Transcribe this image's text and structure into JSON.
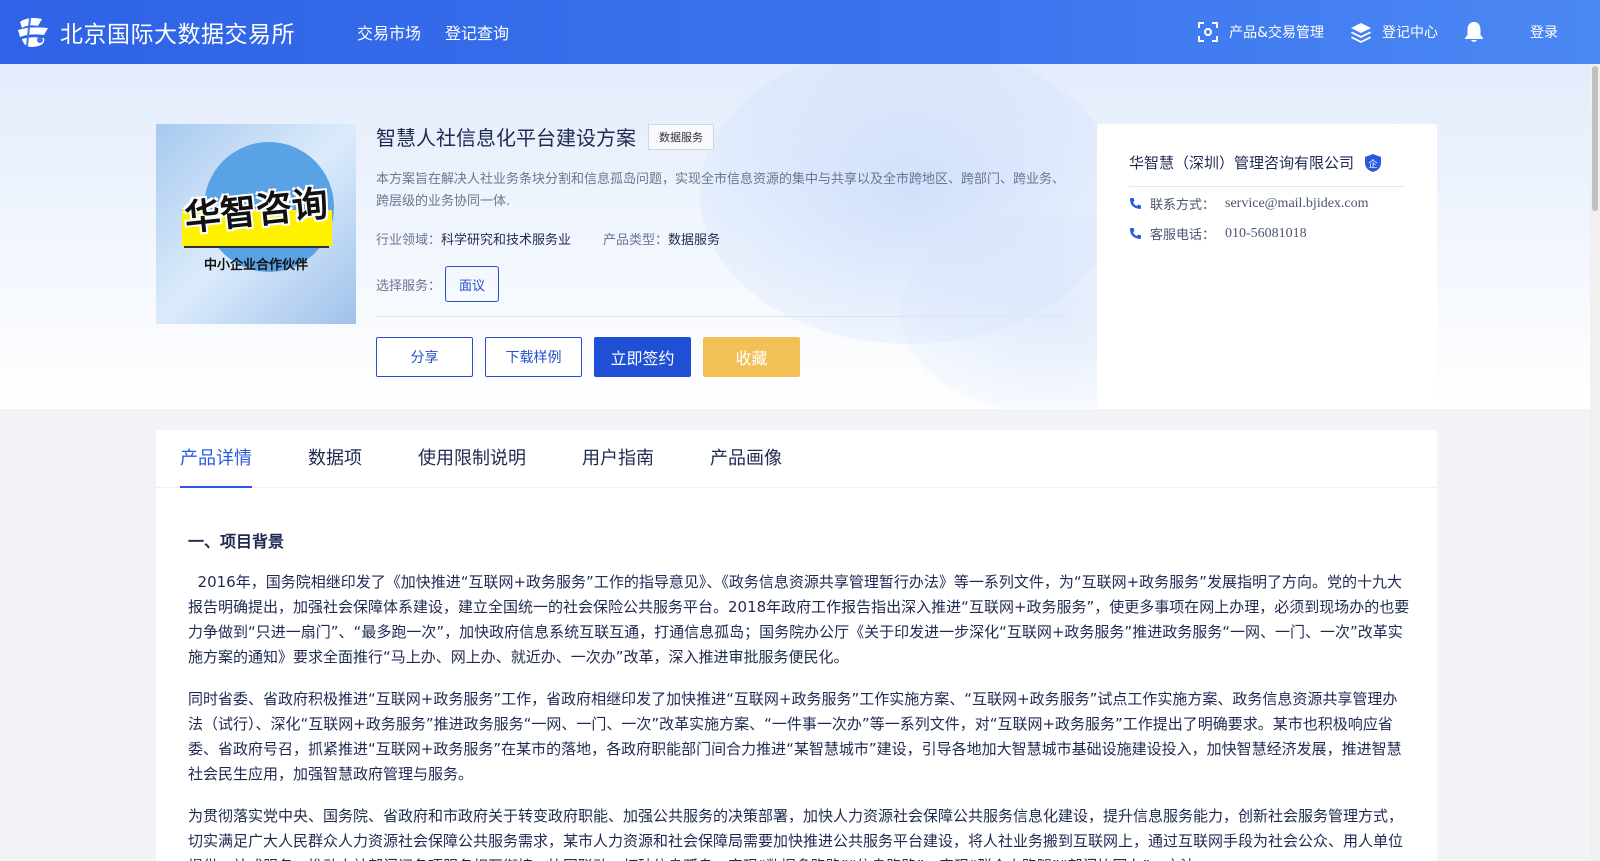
{
  "header": {
    "logo_text": "北京国际大数据交易所",
    "nav": [
      "交易市场",
      "登记查询"
    ],
    "product_mgmt": "产品&交易管理",
    "register_center": "登记中心",
    "login": "登录"
  },
  "product": {
    "image_title": "华智咨询",
    "image_subtitle": "中小企业合作伙伴",
    "title": "智慧人社信息化平台建设方案",
    "tag": "数据服务",
    "description": "本方案旨在解决人社业务条块分割和信息孤岛问题，实现全市信息资源的集中与共享以及全市跨地区、跨部门、跨业务、跨层级的业务协同一体.",
    "industry_label": "行业领域：",
    "industry_value": "科学研究和技术服务业",
    "type_label": "产品类型：",
    "type_value": "数据服务",
    "service_label": "选择服务：",
    "service_option": "面议",
    "actions": {
      "share": "分享",
      "download": "下载样例",
      "sign": "立即签约",
      "favorite": "收藏"
    }
  },
  "company": {
    "name": "华智慧（深圳）管理咨询有限公司",
    "badge": "企",
    "contact_label": "联系方式：",
    "contact_value": "service@mail.bjidex.com",
    "phone_label": "客服电话：",
    "phone_value": "010-56081018"
  },
  "tabs": [
    "产品详情",
    "数据项",
    "使用限制说明",
    "用户指南",
    "产品画像"
  ],
  "active_tab": "产品详情",
  "content": {
    "section_title": "一、项目背景",
    "paragraphs": [
      "  2016年，国务院相继印发了《加快推进“互联网+政务服务”工作的指导意见》、《政务信息资源共享管理暂行办法》等一系列文件，为“互联网+政务服务”发展指明了方向。党的十九大报告明确提出，加强社会保障体系建设，建立全国统一的社会保险公共服务平台。2018年政府工作报告指出深入推进“互联网+政务服务”，使更多事项在网上办理，必须到现场办的也要力争做到“只进一扇门”、“最多跑一次”，加快政府信息系统互联互通，打通信息孤岛；国务院办公厅《关于印发进一步深化“互联网+政务服务”推进政务服务“一网、一门、一次”改革实施方案的通知》要求全面推行“马上办、网上办、就近办、一次办”改革，深入推进审批服务便民化。",
      "同时省委、省政府积极推进“互联网+政务服务”工作，省政府相继印发了加快推进“互联网+政务服务”工作实施方案、“互联网+政务服务”试点工作实施方案、政务信息资源共享管理办法（试行）、深化“互联网+政务服务”推进政务服务“一网、一门、一次”改革实施方案、“一件事一次办”等一系列文件，对“互联网+政务服务”工作提出了明确要求。某市也积极响应省委、省政府号召，抓紧推进“互联网+政务服务”在某市的落地，各政府职能部门间合力推进“某智慧城市”建设，引导各地加大智慧城市基础设施建设投入，加快智慧经济发展，推进智慧社会民生应用，加强智慧政府管理与服务。",
      "为贯彻落实党中央、国务院、省政府和市政府关于转变政府职能、加强公共服务的决策部署，加快人力资源社会保障公共服务信息化建设，提升信息服务能力，创新社会服务管理方式，切实满足广大人民群众人力资源社会保障公共服务需求，某市人力资源和社会保障局需要加快推进公共服务平台建设，将人社业务搬到互联网上，通过互联网手段为社会公众、用人单位提供一站式服务，推动人社部门间各项服务相互衔接、协同联动，打破信息孤岛，实现“数据多跑路”“信息跑路”，实现“群众少跑腿”“部门协同办”，方法"
    ]
  },
  "colors": {
    "header_start": "#2f62e6",
    "header_end": "#4b88f3",
    "primary": "#1f4fd4",
    "favorite": "#f3c055"
  },
  "icons": {
    "product_mgmt": "scan-icon",
    "register_center": "layers-icon",
    "notification": "bell-icon",
    "phone": "phone-icon",
    "verified": "shield-icon"
  }
}
